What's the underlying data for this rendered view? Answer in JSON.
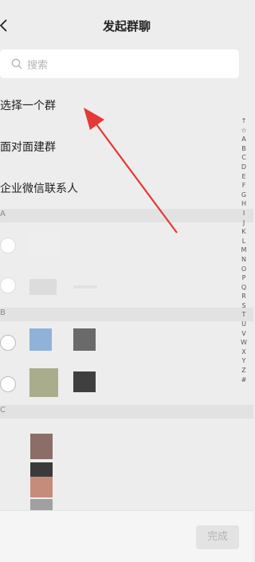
{
  "header": {
    "title": "发起群聊"
  },
  "search": {
    "placeholder": "搜索"
  },
  "options": [
    {
      "label": "选择一个群"
    },
    {
      "label": "面对面建群"
    },
    {
      "label": "企业微信联系人"
    }
  ],
  "sections": [
    {
      "letter": "A"
    },
    {
      "letter": "B"
    },
    {
      "letter": "C"
    }
  ],
  "index_letters": [
    "↑",
    "☆",
    "A",
    "B",
    "C",
    "D",
    "E",
    "F",
    "G",
    "H",
    "I",
    "J",
    "K",
    "L",
    "M",
    "N",
    "O",
    "P",
    "Q",
    "R",
    "S",
    "T",
    "U",
    "V",
    "W",
    "X",
    "Y",
    "Z",
    "#"
  ],
  "footer": {
    "done_label": "完成"
  },
  "colors": {
    "arrow": "#e53935"
  }
}
